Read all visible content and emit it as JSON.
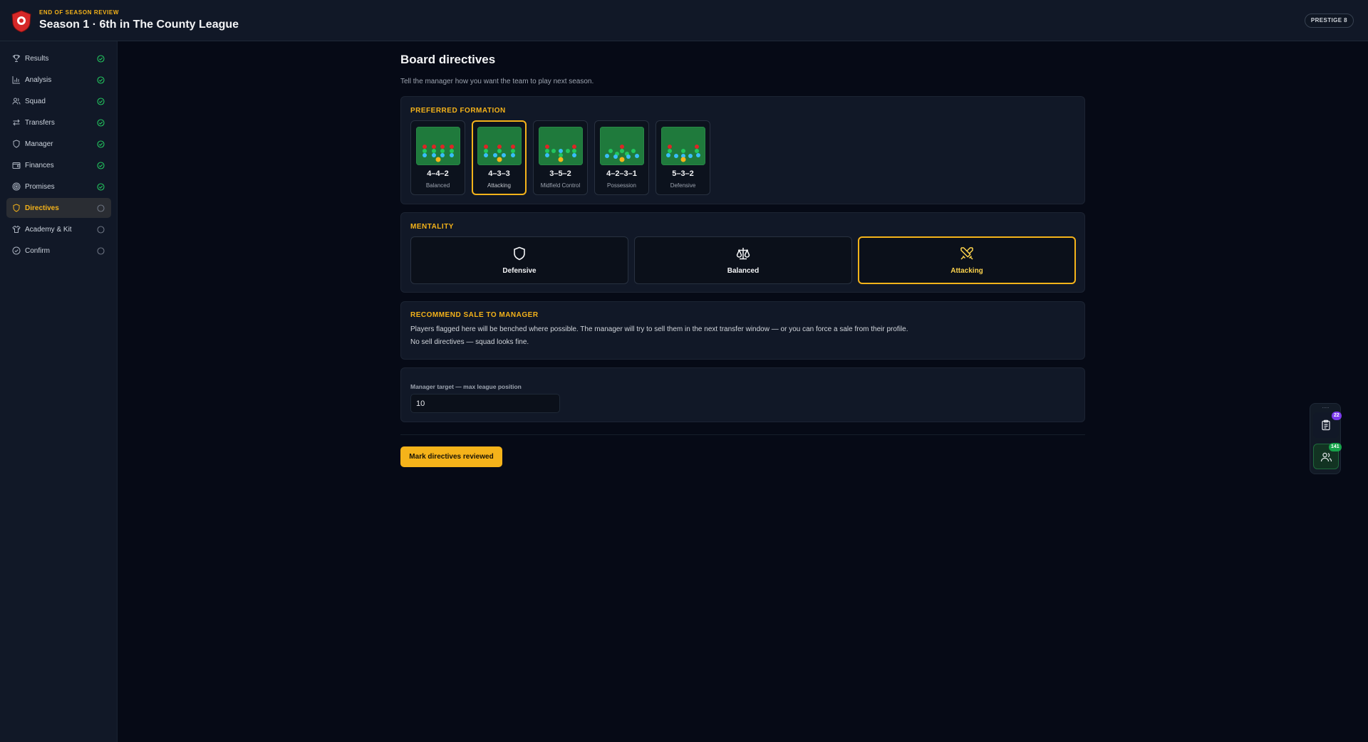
{
  "header": {
    "subtitle": "END OF SEASON REVIEW",
    "title": "Season 1 · 6th in The County League",
    "prestige": "PRESTIGE 8"
  },
  "sidebar": {
    "items": [
      {
        "label": "Results",
        "icon": "trophy-icon",
        "status": "done"
      },
      {
        "label": "Analysis",
        "icon": "bar-chart-icon",
        "status": "done"
      },
      {
        "label": "Squad",
        "icon": "users-icon",
        "status": "done"
      },
      {
        "label": "Transfers",
        "icon": "transfer-arrows-icon",
        "status": "done"
      },
      {
        "label": "Manager",
        "icon": "shield-icon",
        "status": "done"
      },
      {
        "label": "Finances",
        "icon": "wallet-icon",
        "status": "done"
      },
      {
        "label": "Promises",
        "icon": "target-icon",
        "status": "done"
      },
      {
        "label": "Directives",
        "icon": "shield-icon",
        "status": "pending",
        "active": true
      },
      {
        "label": "Academy & Kit",
        "icon": "shirt-icon",
        "status": "pending"
      },
      {
        "label": "Confirm",
        "icon": "check-circle-icon",
        "status": "pending"
      }
    ]
  },
  "main": {
    "title": "Board directives",
    "description": "Tell the manager how you want the team to play next season.",
    "formation": {
      "label": "PREFERRED FORMATION",
      "selected": "4-3-3",
      "options": [
        {
          "name": "4–4–2",
          "style": "Balanced"
        },
        {
          "name": "4–3–3",
          "style": "Attacking"
        },
        {
          "name": "3–5–2",
          "style": "Midfield Control"
        },
        {
          "name": "4–2–3–1",
          "style": "Possession"
        },
        {
          "name": "5–3–2",
          "style": "Defensive"
        }
      ]
    },
    "mentality": {
      "label": "MENTALITY",
      "selected": "Attacking",
      "options": [
        {
          "label": "Defensive",
          "icon": "shield-icon"
        },
        {
          "label": "Balanced",
          "icon": "scales-icon"
        },
        {
          "label": "Attacking",
          "icon": "crossed-swords-icon"
        }
      ]
    },
    "sale": {
      "label": "RECOMMEND SALE TO MANAGER",
      "text": "Players flagged here will be benched where possible. The manager will try to sell them in the next transfer window — or you can force a sale from their profile.",
      "empty": "No sell directives — squad looks fine."
    },
    "target": {
      "label": "Manager target — max league position",
      "value": "10"
    },
    "submit_label": "Mark directives reviewed"
  },
  "dock": {
    "tasks_badge": "22",
    "people_badge": "141"
  },
  "colors": {
    "accent": "#f5b31a",
    "done": "#22c55e",
    "badge_purple": "#7c3aed",
    "badge_green": "#16a34a",
    "pitch": "#1f7a3c"
  }
}
